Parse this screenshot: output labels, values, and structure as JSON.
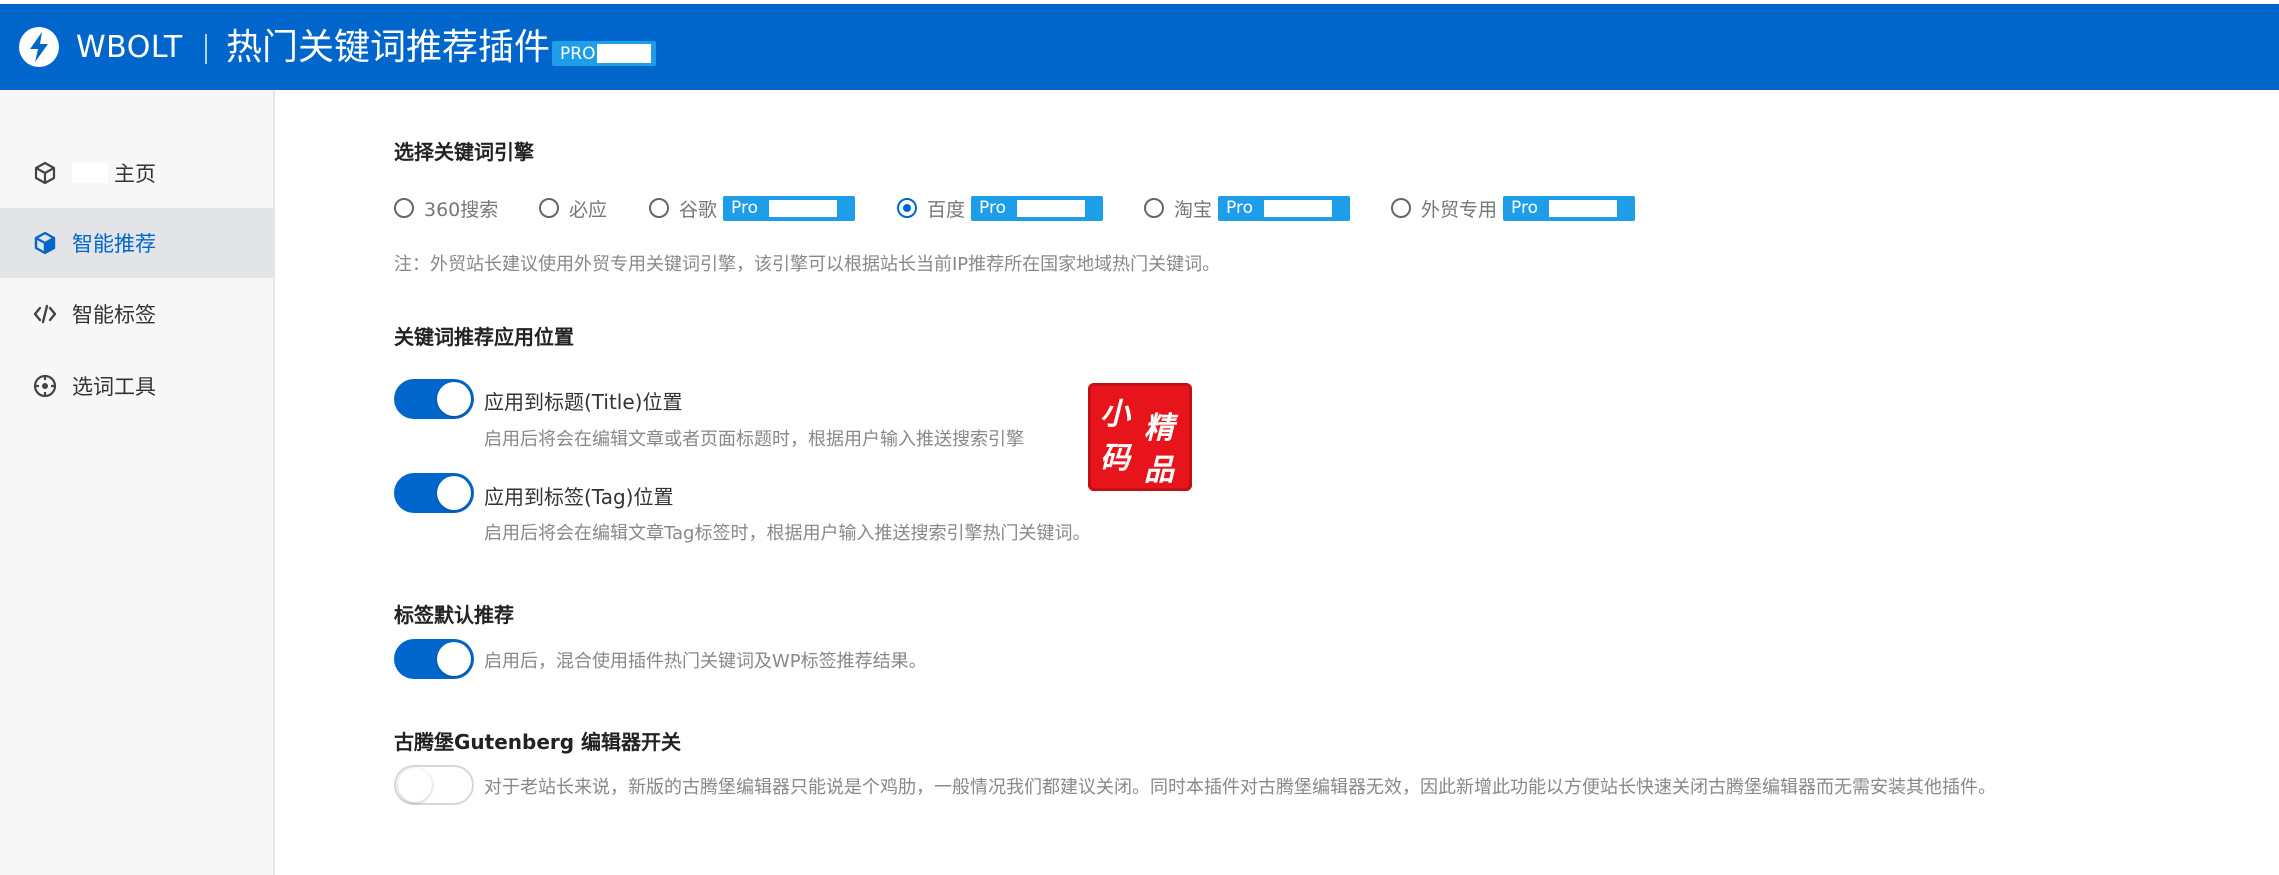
{
  "header": {
    "brand": "WBOLT",
    "title": "热门关键词推荐插件",
    "pro_badge": "PRO"
  },
  "sidebar": {
    "items": [
      {
        "label": "主页",
        "icon": "cube-outline-icon",
        "active": false
      },
      {
        "label": "智能推荐",
        "icon": "cube-icon",
        "active": true
      },
      {
        "label": "智能标签",
        "icon": "code-icon",
        "active": false
      },
      {
        "label": "选词工具",
        "icon": "target-icon",
        "active": false
      }
    ]
  },
  "engine": {
    "title": "选择关键词引擎",
    "options": [
      {
        "label": "360搜索",
        "pro": false,
        "checked": false
      },
      {
        "label": "必应",
        "pro": false,
        "checked": false
      },
      {
        "label": "谷歌",
        "pro": true,
        "checked": false
      },
      {
        "label": "百度",
        "pro": true,
        "checked": true
      },
      {
        "label": "淘宝",
        "pro": true,
        "checked": false
      },
      {
        "label": "外贸专用",
        "pro": true,
        "checked": false
      }
    ],
    "pro_label": "Pro",
    "note": "注：外贸站长建议使用外贸专用关键词引擎，该引擎可以根据站长当前IP推荐所在国家地域热门关键词。"
  },
  "position": {
    "title": "关键词推荐应用位置",
    "title_toggle": {
      "label": "应用到标题(Title)位置",
      "desc": "启用后将会在编辑文章或者页面标题时，根据用户输入推送搜索引擎",
      "on": true
    },
    "tag_toggle": {
      "label": "应用到标签(Tag)位置",
      "desc": "启用后将会在编辑文章Tag标签时，根据用户输入推送搜索引擎热门关键词。",
      "on": true
    }
  },
  "tag_default": {
    "title": "标签默认推荐",
    "desc": "启用后，混合使用插件热门关键词及WP标签推荐结果。",
    "on": true
  },
  "gutenberg": {
    "title": "古腾堡Gutenberg 编辑器开关",
    "desc": "对于老站长来说，新版的古腾堡编辑器只能说是个鸡肋，一般情况我们都建议关闭。同时本插件对古腾堡编辑器无效，因此新增此功能以方便站长快速关闭古腾堡编辑器而无需安装其他插件。",
    "on": false
  },
  "stamp": {
    "chars": [
      "小",
      "精",
      "码",
      "品"
    ]
  },
  "colors": {
    "accent": "#0066cc",
    "pro_badge": "#1e9ee8",
    "stamp": "#e8141c"
  }
}
